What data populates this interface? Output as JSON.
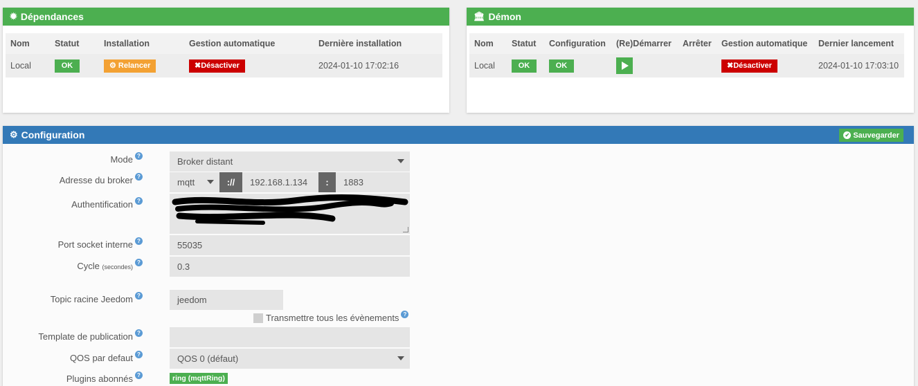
{
  "deps": {
    "title": "Dépendances",
    "headers": [
      "Nom",
      "Statut",
      "Installation",
      "Gestion automatique",
      "Dernière installation"
    ],
    "row": {
      "name": "Local",
      "status": "OK",
      "install": "Relancer",
      "auto": "Désactiver",
      "last": "2024-01-10 17:02:16"
    }
  },
  "daemon": {
    "title": "Démon",
    "headers": [
      "Nom",
      "Statut",
      "Configuration",
      "(Re)Démarrer",
      "Arrêter",
      "Gestion automatique",
      "Dernier lancement"
    ],
    "row": {
      "name": "Local",
      "status": "OK",
      "config": "OK",
      "auto": "Désactiver",
      "last": "2024-01-10 17:03:10"
    }
  },
  "config": {
    "title": "Configuration",
    "save": "Sauvegarder",
    "mode_label": "Mode",
    "mode_value": "Broker distant",
    "broker_label": "Adresse du broker",
    "broker_proto": "mqtt",
    "broker_sep1": "://",
    "broker_host": "192.168.1.134",
    "broker_sep2": ":",
    "broker_port": "1883",
    "auth_label": "Authentification",
    "socket_label": "Port socket interne",
    "socket_value": "55035",
    "cycle_label": "Cycle",
    "cycle_unit": "(secondes)",
    "cycle_value": "0.3",
    "topic_label": "Topic racine Jeedom",
    "topic_value": "jeedom",
    "transmit_label": "Transmettre tous les évènements",
    "template_label": "Template de publication",
    "template_value": "",
    "qos_label": "QOS par defaut",
    "qos_value": "QOS 0 (défaut)",
    "plugins_label": "Plugins abonnés",
    "plugins_badge": "ring (mqttRing)"
  },
  "colors": {
    "green": "#4caf50",
    "blue": "#3379b7",
    "orange": "#f3a133",
    "red": "#cc0000"
  }
}
